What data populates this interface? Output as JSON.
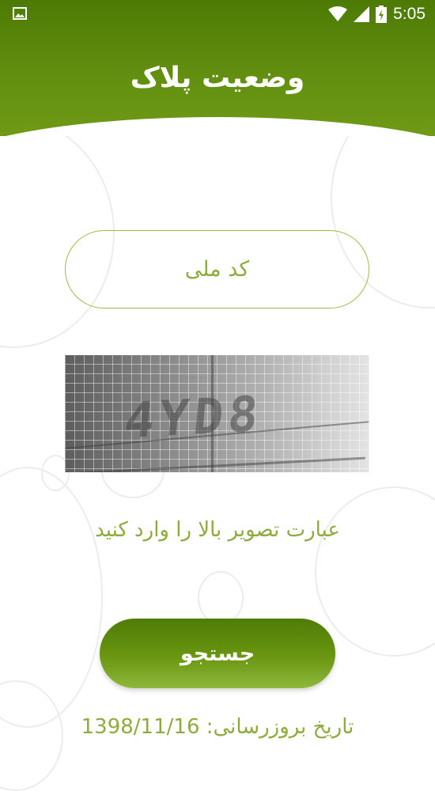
{
  "status_bar": {
    "time": "5:05",
    "icons": [
      "image-notification-icon",
      "wifi-icon",
      "signal-icon",
      "battery-charging-icon"
    ]
  },
  "header": {
    "title": "وضعیت پلاک"
  },
  "form": {
    "national_code_placeholder": "کد ملی",
    "captcha_text": "4YD8",
    "captcha_hint": "عبارت تصویر بالا را وارد کنید",
    "search_label": "جستجو"
  },
  "footer": {
    "update_label": "تاریخ بروزرسانی:",
    "update_date": "1398/11/16"
  },
  "colors": {
    "primary": "#5f8c0e",
    "accent_text": "#8eab3e",
    "background": "#ffffff"
  }
}
